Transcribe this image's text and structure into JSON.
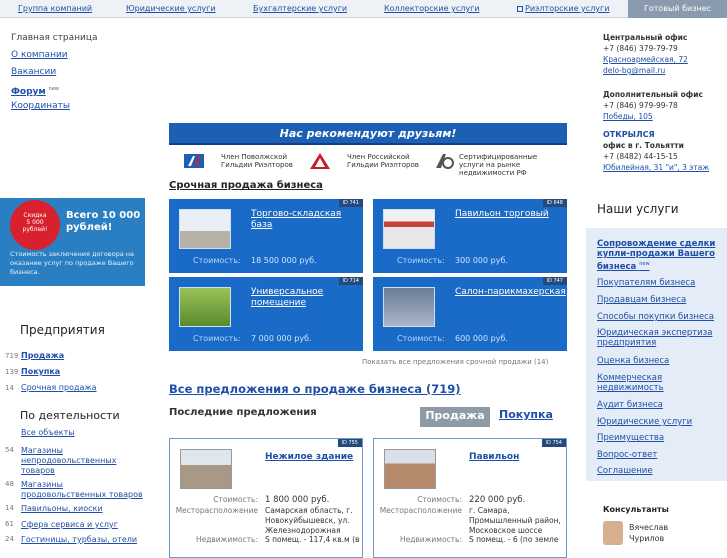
{
  "top_tabs": [
    {
      "label": "Группа компаний"
    },
    {
      "label": "Юридические услуги"
    },
    {
      "label": "Бухгалтерские услуги"
    },
    {
      "label": "Коллекторские услуги"
    },
    {
      "label": "Риэлторские услуги"
    },
    {
      "label": "Готовый бизнес"
    }
  ],
  "left_nav": {
    "home": "Главная страница",
    "about": "О компании",
    "vacancies": "Вакансии",
    "forum": "Форум",
    "forum_badge": "new",
    "contacts": "Координаты"
  },
  "promo": {
    "badge_line1": "Скидка",
    "badge_line2": "5 000",
    "badge_line3": "рублей!",
    "headline": "Всего 10 000 рублей!",
    "text": "Стоимость заключения договора на оказание услуг по продаже Вашего бизнеса."
  },
  "enterprises": {
    "title": "Предприятия",
    "items": [
      {
        "count": "719",
        "label": "Продажа"
      },
      {
        "count": "139",
        "label": "Покупка"
      },
      {
        "count": "14",
        "label": "Срочная продажа"
      }
    ]
  },
  "by_activity": {
    "title": "По деятельности",
    "items": [
      {
        "count": "",
        "label": "Все объекты"
      },
      {
        "count": "54",
        "label": "Магазины непродовольственных товаров"
      },
      {
        "count": "48",
        "label": "Магазины продовольственных товаров"
      },
      {
        "count": "14",
        "label": "Павильоны, киоски"
      },
      {
        "count": "61",
        "label": "Сфера сервиса и услуг"
      },
      {
        "count": "24",
        "label": "Гостиницы, турбазы, отели"
      }
    ]
  },
  "recommend_banner": "Нас рекомендуют друзьям!",
  "members": [
    "Член Поволжской Гильдии Риэлторов",
    "Член Российской Гильдии Риэлторов",
    "Сертифицированные услуги на рынке недвижимости РФ"
  ],
  "urgent": {
    "title": "Срочная продажа бизнеса",
    "price_label": "Стоимость:",
    "cards": [
      {
        "id": "ID 741",
        "name": "Торгово-складская база",
        "price": "18 500 000  руб."
      },
      {
        "id": "ID 648",
        "name": "Павильон торговый",
        "price": "300 000  руб."
      },
      {
        "id": "ID 714",
        "name": "Универсальное помещение",
        "price": "7 000 000  руб."
      },
      {
        "id": "ID 747",
        "name": "Салон-парикмахерская",
        "price": "600 000  руб."
      }
    ],
    "show_all": "Показать все предложения срочной продажи (14)"
  },
  "all_offers": "Все предложения о продаже бизнеса (719)",
  "latest": {
    "title": "Последние предложения",
    "tab_sale": "Продажа",
    "tab_buy": "Покупка",
    "labels": {
      "price": "Стоимость:",
      "location": "Месторасположение",
      "area": "Недвижимость:"
    },
    "cards": [
      {
        "id": "ID 755",
        "name": "Нежилое здание",
        "price": "1 800 000  руб.",
        "location": "Самарская область, г. Новокуйбышевск, ул. Железнодорожная",
        "area": "S помещ. - 117,4 кв.м (в"
      },
      {
        "id": "ID 754",
        "name": "Павильон",
        "price": "220 000  руб.",
        "location": "г. Самара, Промышленный район, Московское шоссе",
        "area": "S помещ. - 6 (по земле"
      }
    ]
  },
  "right_info": {
    "central_title": "Центральный офис",
    "central_phone": "+7 (846) 379-79-79",
    "central_address": "Красноармейская, 72",
    "central_email": "delo-bg@mail.ru",
    "extra_title": "Дополнительный офис",
    "extra_phone": "+7 (846) 979-99-78",
    "extra_address": "Победы, 105",
    "opened": "ОТКРЫЛСЯ",
    "opened_sub": "офис в г. Тольятти",
    "tlt_phone": "+7 (8482) 44-15-15",
    "tlt_address": "Юбилейная, 31 \"и\", 3 этаж"
  },
  "services": {
    "title": "Наши услуги",
    "featured": "Сопровождение сделки купли-продажи Вашего бизнеса",
    "featured_badge": "new",
    "items": [
      "Покупателям бизнеса",
      "Продавцам бизнеса",
      "Способы покупки бизнеса",
      "Юридическая экспертиза предприятия",
      "Оценка бизнеса",
      "Коммерческая недвижимость",
      "Аудит бизнеса",
      "Юридические услуги",
      "Преимущества",
      "Вопрос-ответ",
      "Соглашение"
    ]
  },
  "consultants": {
    "title": "Консультанты",
    "name_first": "Вячеслав",
    "name_last": "Чурилов"
  }
}
